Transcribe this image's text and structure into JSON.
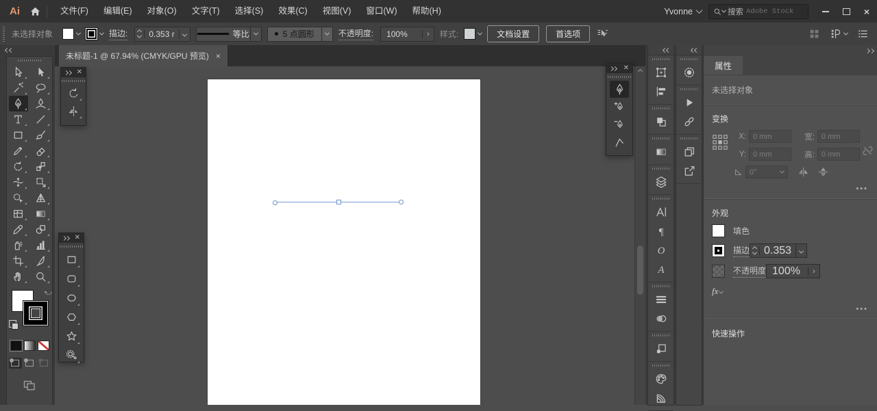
{
  "menubar": {
    "logo": "Ai",
    "menus": [
      {
        "name": "file",
        "label": "文件(F)"
      },
      {
        "name": "edit",
        "label": "编辑(E)"
      },
      {
        "name": "object",
        "label": "对象(O)"
      },
      {
        "name": "type",
        "label": "文字(T)"
      },
      {
        "name": "select",
        "label": "选择(S)"
      },
      {
        "name": "effect",
        "label": "效果(C)"
      },
      {
        "name": "view",
        "label": "视图(V)"
      },
      {
        "name": "window",
        "label": "窗口(W)"
      },
      {
        "name": "help",
        "label": "帮助(H)"
      }
    ],
    "user": "Yvonne",
    "search_prefix": "搜索",
    "search_placeholder": "Adobe Stock"
  },
  "controlbar": {
    "status": "未选择对象",
    "stroke_label": "描边:",
    "stroke_value": "0.353 r",
    "profile": "等比",
    "brush": "5 点圆形",
    "opacity_label": "不透明度:",
    "opacity_value": "100%",
    "style_label": "样式:",
    "document_setup": "文档设置",
    "preferences": "首选项"
  },
  "tabbar": {
    "title": "未标题-1 @ 67.94% (CMYK/GPU 预览)",
    "close": "×"
  },
  "tools": {
    "main": [
      {
        "name": "selection-tool",
        "icon": "arrowO"
      },
      {
        "name": "direct-selection-tool",
        "icon": "arrowF"
      },
      {
        "name": "magic-wand-tool",
        "icon": "wand"
      },
      {
        "name": "lasso-tool",
        "icon": "lasso"
      },
      {
        "name": "pen-tool",
        "icon": "pen",
        "active": true
      },
      {
        "name": "curvature-tool",
        "icon": "curvature"
      },
      {
        "name": "type-tool",
        "icon": "typeT"
      },
      {
        "name": "line-segment-tool",
        "icon": "lineT"
      },
      {
        "name": "rectangle-tool",
        "icon": "rectT"
      },
      {
        "name": "paintbrush-tool",
        "icon": "brushT"
      },
      {
        "name": "shaper-tool",
        "icon": "pencilT"
      },
      {
        "name": "eraser-tool",
        "icon": "eraserT"
      },
      {
        "name": "rotate-tool",
        "icon": "rotateT"
      },
      {
        "name": "scale-tool",
        "icon": "scaleT"
      },
      {
        "name": "width-tool",
        "icon": "widthT"
      },
      {
        "name": "free-transform-tool",
        "icon": "freeT"
      },
      {
        "name": "shape-builder-tool",
        "icon": "shapeB"
      },
      {
        "name": "perspective-grid-tool",
        "icon": "perspT"
      },
      {
        "name": "mesh-tool",
        "icon": "meshT"
      },
      {
        "name": "gradient-tool",
        "icon": "gradT"
      },
      {
        "name": "eyedropper-tool",
        "icon": "eyedT"
      },
      {
        "name": "blend-tool",
        "icon": "blendT"
      },
      {
        "name": "symbol-sprayer-tool",
        "icon": "sprayT"
      },
      {
        "name": "column-graph-tool",
        "icon": "graphT"
      },
      {
        "name": "artboard-tool",
        "icon": "artbT"
      },
      {
        "name": "slice-tool",
        "icon": "sliceT"
      },
      {
        "name": "hand-tool",
        "icon": "handT"
      },
      {
        "name": "zoom-tool",
        "icon": "zoomT"
      }
    ],
    "rotate_panel": [
      {
        "name": "rotate-tool",
        "icon": "rotateT"
      },
      {
        "name": "reflect-tool",
        "icon": "reflectT"
      }
    ],
    "pen_panel": [
      {
        "name": "pen-tool",
        "icon": "pen",
        "active": true
      },
      {
        "name": "add-anchor-point-tool",
        "icon": "penPlus"
      },
      {
        "name": "delete-anchor-point-tool",
        "icon": "penMinus"
      },
      {
        "name": "anchor-point-tool",
        "icon": "anchorT"
      }
    ],
    "shapes_panel": [
      {
        "name": "rectangle-tool",
        "icon": "rectT"
      },
      {
        "name": "rounded-rectangle-tool",
        "icon": "rrectT"
      },
      {
        "name": "ellipse-tool",
        "icon": "ellipseT"
      },
      {
        "name": "polygon-tool",
        "icon": "hexT"
      },
      {
        "name": "star-tool",
        "icon": "starT"
      },
      {
        "name": "flare-tool",
        "icon": "flareT"
      }
    ]
  },
  "docks": {
    "col1": [
      [
        {
          "name": "transform-panel",
          "icon": "transformP"
        },
        {
          "name": "align-panel",
          "icon": "alignP"
        }
      ],
      [
        {
          "name": "pathfinder-panel",
          "icon": "pathfP"
        }
      ],
      [
        {
          "name": "gradient-panel",
          "icon": "gradT"
        }
      ],
      [
        {
          "name": "layers-panel",
          "icon": "layersP"
        }
      ],
      [
        {
          "name": "character-panel",
          "icon": "charP"
        },
        {
          "name": "paragraph-panel",
          "icon": "paraP"
        },
        {
          "name": "opentype-panel",
          "icon": "otP"
        },
        {
          "name": "glyphs-panel",
          "icon": "glyphP"
        }
      ],
      [
        {
          "name": "stroke-panel",
          "icon": "strokeP"
        },
        {
          "name": "transparency-panel",
          "icon": "transpP"
        }
      ],
      [
        {
          "name": "symbols-panel",
          "icon": "symP"
        }
      ],
      [
        {
          "name": "swatches-panel",
          "icon": "paletteP"
        },
        {
          "name": "color-guide-panel",
          "icon": "fanP"
        }
      ]
    ],
    "col2": [
      [
        {
          "name": "color-panel",
          "icon": "colorP"
        }
      ],
      [
        {
          "name": "actions-panel",
          "icon": "playP"
        },
        {
          "name": "links-panel",
          "icon": "linksP"
        }
      ],
      [
        {
          "name": "artboards-panel",
          "icon": "artbsP"
        },
        {
          "name": "export-panel",
          "icon": "exportP"
        }
      ]
    ]
  },
  "properties": {
    "tab": "属性",
    "status": "未选择对象",
    "transform": {
      "title": "变换",
      "x_label": "X:",
      "y_label": "Y:",
      "w_label": "宽:",
      "h_label": "高:",
      "x_val": "0 mm",
      "y_val": "0 mm",
      "w_val": "0 mm",
      "h_val": "0 mm",
      "angle_val": "0°",
      "more": "•••"
    },
    "appearance": {
      "title": "外观",
      "fill_label": "填色",
      "stroke_label": "描边",
      "stroke_val": "0.353",
      "opacity_label": "不透明度",
      "opacity_val": "100%",
      "fx_label": "fx",
      "more": "•••"
    },
    "quick_actions": {
      "title": "快速操作"
    }
  }
}
